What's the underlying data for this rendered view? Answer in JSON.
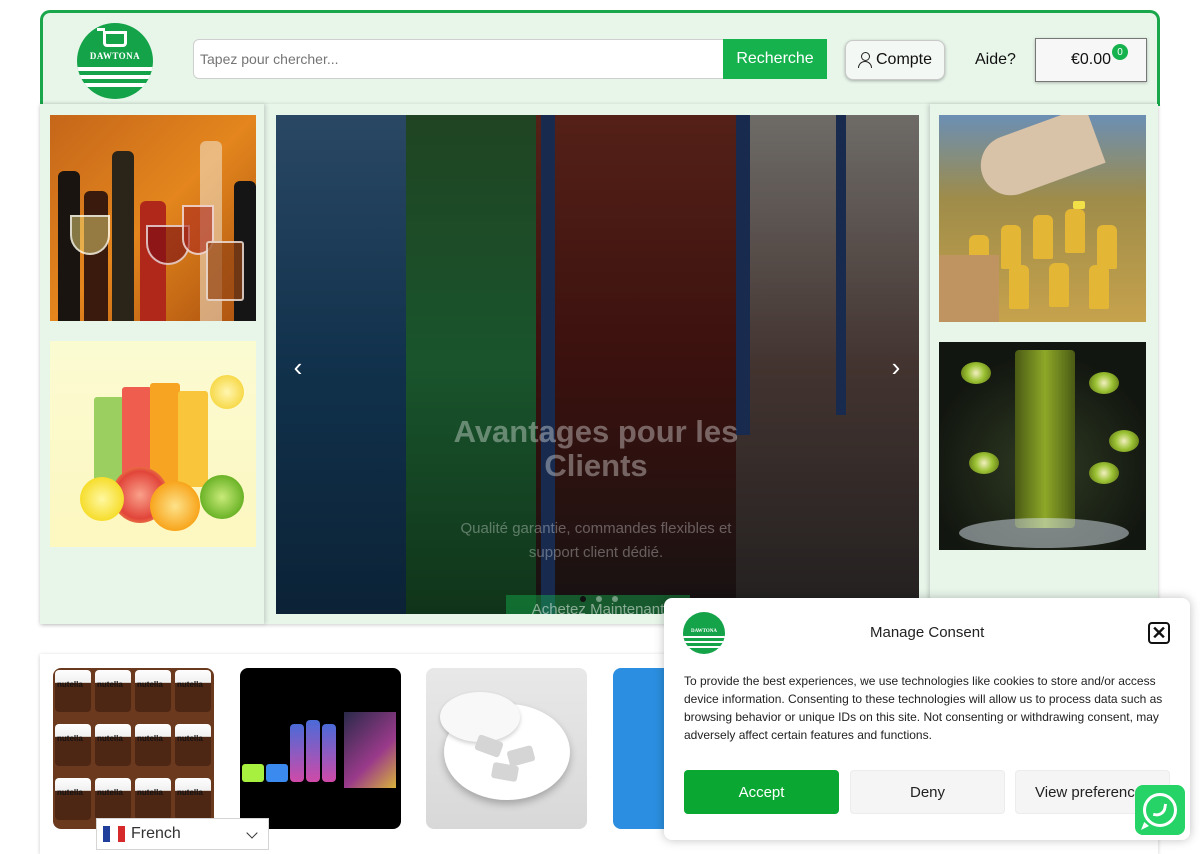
{
  "header": {
    "logo_text": "DAWTONA",
    "search_placeholder": "Tapez pour chercher...",
    "search_button": "Recherche",
    "account_label": "Compte",
    "help_label": "Aide?",
    "cart_total": "€0.00",
    "cart_count": "0"
  },
  "hero": {
    "slider_title": "Avantages pour les Clients",
    "slider_subtitle": "Qualité garantie, commandes flexibles et support client dédié.",
    "slider_cta": "Achetez Maintenant",
    "prev_arrow": "‹",
    "next_arrow": "›",
    "slide_count": 3,
    "active_slide": 1
  },
  "left_thumbnails": [
    {
      "icon": "wine-bottles-image"
    },
    {
      "icon": "juice-glasses-image"
    }
  ],
  "right_thumbnails": [
    {
      "icon": "oil-bottles-image"
    },
    {
      "icon": "cream-deluxe-can-image"
    }
  ],
  "products": [
    {
      "icon": "nutella-jars-image",
      "jar_label": "nutella"
    },
    {
      "icon": "cream-charger-boxes-image"
    },
    {
      "icon": "snus-pouches-image"
    },
    {
      "icon": "blue-product-image"
    }
  ],
  "language": {
    "selected": "French"
  },
  "consent": {
    "logo_text": "DAWTONA",
    "title": "Manage Consent",
    "close_glyph": "✕",
    "body": "To provide the best experiences, we use technologies like cookies to store and/or access device information. Consenting to these technologies will allow us to process data such as browsing behavior or unique IDs on this site. Not consenting or withdrawing consent, may adversely affect certain features and functions.",
    "accept": "Accept",
    "deny": "Deny",
    "view_preferences": "View preferences"
  },
  "colors": {
    "brand_green": "#15b24e",
    "header_bg": "#e8f6ea",
    "accept_green": "#0aa832",
    "whatsapp_green": "#25d366"
  }
}
